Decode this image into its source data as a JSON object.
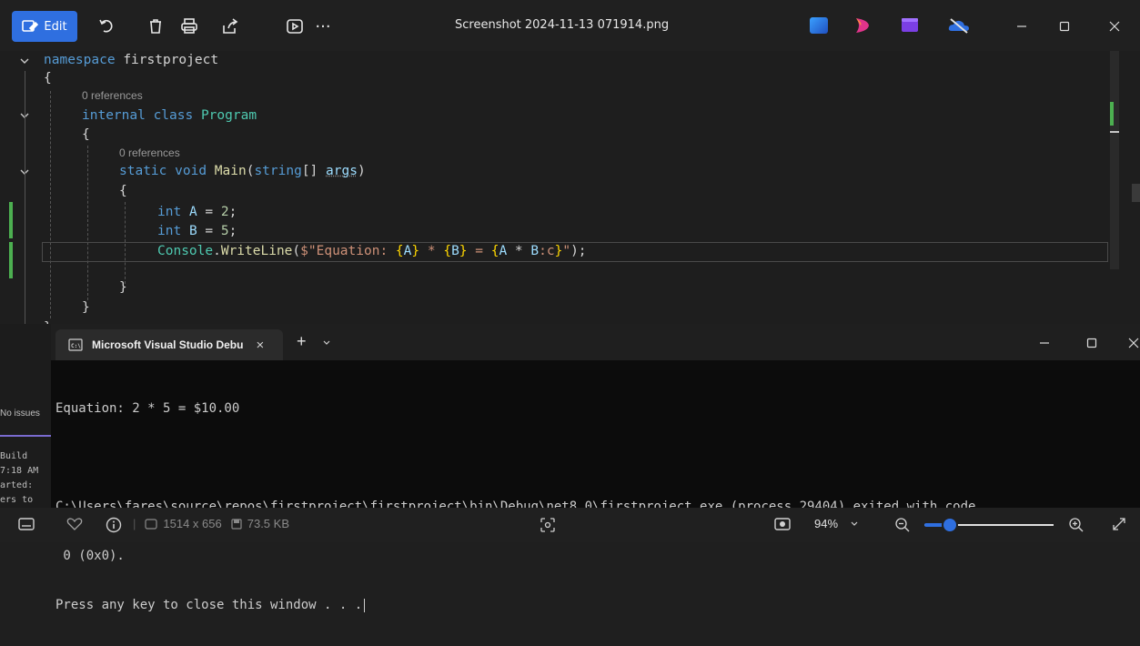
{
  "toolbar": {
    "edit_label": "Edit",
    "title": "Screenshot 2024-11-13 071914.png",
    "more_label": "···"
  },
  "editor": {
    "lines": {
      "ns_kw": "namespace",
      "ns_name": "firstproject",
      "brace_open_1": "{",
      "ref1": "0 references",
      "class_kw": "internal class",
      "class_name": "Program",
      "brace_open_2": "{",
      "ref2": "0 references",
      "main_kw1": "static",
      "main_kw2": "void",
      "main_fn": "Main",
      "main_paren": "(",
      "main_ptype": "string",
      "main_rest": "[] ",
      "main_arg": "args",
      "main_close": ")",
      "brace_open_3": "{",
      "a_kw": "int",
      "a_var": "A",
      "a_eq": " = ",
      "a_num": "2",
      "a_semi": ";",
      "b_kw": "int",
      "b_var": "B",
      "b_eq": " = ",
      "b_num": "5",
      "b_semi": ";",
      "cw_type": "Console",
      "cw_dot": ".",
      "cw_fn": "WriteLine",
      "cw_open": "(",
      "cw_s1": "$\"Equation: ",
      "cw_i1o": "{",
      "cw_v1": "A",
      "cw_i1c": "}",
      "cw_s2": " * ",
      "cw_i2o": "{",
      "cw_v2": "B",
      "cw_i2c": "}",
      "cw_s3": " = ",
      "cw_i3o": "{",
      "cw_v3": "A",
      "cw_op": " * ",
      "cw_v4": "B",
      "cw_fmt": ":c",
      "cw_i3c": "}",
      "cw_s4": "\"",
      "cw_close": ");",
      "brace_close_3": "}",
      "brace_close_2": "}",
      "brace_close_1": "}"
    }
  },
  "left_panel": {
    "issues": "No issues",
    "build": "Build",
    "time": "7:18 AM",
    "started": "arted:",
    "ers_to": "ers to"
  },
  "terminal": {
    "tab_label": "Microsoft Visual Studio Debu",
    "close_tab": "×",
    "add_tab": "+",
    "output": [
      "Equation: 2 * 5 = $10.00",
      "",
      "C:\\Users\\fares\\source\\repos\\firstproject\\firstproject\\bin\\Debug\\net8.0\\firstproject.exe (process 29404) exited with code",
      " 0 (0x0).",
      "Press any key to close this window . . ."
    ]
  },
  "statusbar": {
    "dimensions": "1514 x 656",
    "filesize": "73.5 KB",
    "zoom": "94%",
    "zoom_level": 0.2
  },
  "colors": {
    "accent": "#2f6fe0",
    "keyword": "#569cd6",
    "type": "#4ec9b0",
    "function": "#dcdcaa",
    "string": "#ce9178",
    "number": "#b5cea8",
    "variable": "#9cdcfe",
    "gutter_change": "#4caf50"
  }
}
